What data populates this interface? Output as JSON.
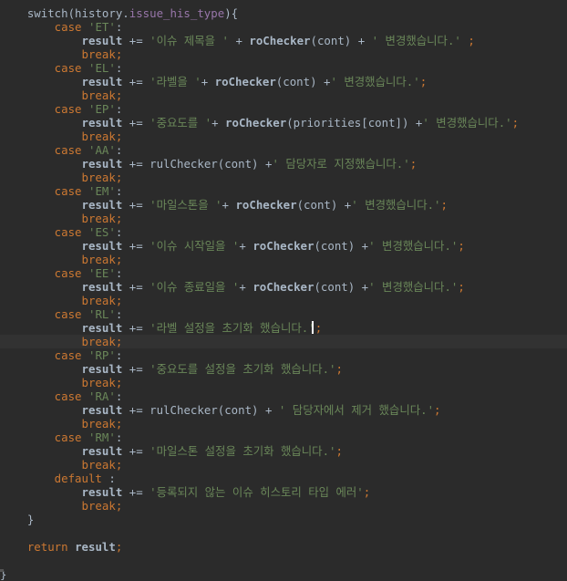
{
  "colors": {
    "background": "#2b2b2b",
    "current_line": "#323232",
    "default_text": "#a9b7c6",
    "keyword": "#cc7832",
    "string": "#6a8759",
    "function": "#ffc66d",
    "field": "#9876aa",
    "caret": "#ffffff"
  },
  "editor": {
    "caret_line": 24,
    "lines": [
      [
        {
          "t": "    switch(history.",
          "c": "plain"
        },
        {
          "t": "issue_his_type",
          "c": "fld"
        },
        {
          "t": "){",
          "c": "plain"
        }
      ],
      [
        {
          "t": "        case ",
          "c": "kw"
        },
        {
          "t": "'ET'",
          "c": "str"
        },
        {
          "t": ":",
          "c": "plain"
        }
      ],
      [
        {
          "t": "            result ",
          "c": "plain bold"
        },
        {
          "t": "+= ",
          "c": "plain"
        },
        {
          "t": "'이슈 제목을 ' ",
          "c": "str"
        },
        {
          "t": "+ ",
          "c": "plain"
        },
        {
          "t": "roChecker",
          "c": "plain bold"
        },
        {
          "t": "(cont) + ",
          "c": "plain"
        },
        {
          "t": "' 변경했습니다.' ",
          "c": "str"
        },
        {
          "t": ";",
          "c": "kw"
        }
      ],
      [
        {
          "t": "            break",
          "c": "kw"
        },
        {
          "t": ";",
          "c": "kw"
        }
      ],
      [
        {
          "t": "        case ",
          "c": "kw"
        },
        {
          "t": "'EL'",
          "c": "str"
        },
        {
          "t": ":",
          "c": "plain"
        }
      ],
      [
        {
          "t": "            result ",
          "c": "plain bold"
        },
        {
          "t": "+= ",
          "c": "plain"
        },
        {
          "t": "'라벨을 '",
          "c": "str"
        },
        {
          "t": "+ ",
          "c": "plain"
        },
        {
          "t": "roChecker",
          "c": "plain bold"
        },
        {
          "t": "(cont) +",
          "c": "plain"
        },
        {
          "t": "' 변경했습니다.'",
          "c": "str"
        },
        {
          "t": ";",
          "c": "kw"
        }
      ],
      [
        {
          "t": "            break",
          "c": "kw"
        },
        {
          "t": ";",
          "c": "kw"
        }
      ],
      [
        {
          "t": "        case ",
          "c": "kw"
        },
        {
          "t": "'EP'",
          "c": "str"
        },
        {
          "t": ":",
          "c": "plain"
        }
      ],
      [
        {
          "t": "            result ",
          "c": "plain bold"
        },
        {
          "t": "+= ",
          "c": "plain"
        },
        {
          "t": "'중요도를 '",
          "c": "str"
        },
        {
          "t": "+ ",
          "c": "plain"
        },
        {
          "t": "roChecker",
          "c": "plain bold"
        },
        {
          "t": "(priorities[cont]) +",
          "c": "plain"
        },
        {
          "t": "' 변경했습니다.'",
          "c": "str"
        },
        {
          "t": ";",
          "c": "kw"
        }
      ],
      [
        {
          "t": "            break",
          "c": "kw"
        },
        {
          "t": ";",
          "c": "kw"
        }
      ],
      [
        {
          "t": "        case ",
          "c": "kw"
        },
        {
          "t": "'AA'",
          "c": "str"
        },
        {
          "t": ":",
          "c": "plain"
        }
      ],
      [
        {
          "t": "            result ",
          "c": "plain bold"
        },
        {
          "t": "+= ",
          "c": "plain"
        },
        {
          "t": "rulChecker",
          "c": "plain"
        },
        {
          "t": "(cont) +",
          "c": "plain"
        },
        {
          "t": "' 담당자로 지정했습니다.'",
          "c": "str"
        },
        {
          "t": ";",
          "c": "kw"
        }
      ],
      [
        {
          "t": "            break",
          "c": "kw"
        },
        {
          "t": ";",
          "c": "kw"
        }
      ],
      [
        {
          "t": "        case ",
          "c": "kw"
        },
        {
          "t": "'EM'",
          "c": "str"
        },
        {
          "t": ":",
          "c": "plain"
        }
      ],
      [
        {
          "t": "            result ",
          "c": "plain bold"
        },
        {
          "t": "+= ",
          "c": "plain"
        },
        {
          "t": "'마일스톤을 '",
          "c": "str"
        },
        {
          "t": "+ ",
          "c": "plain"
        },
        {
          "t": "roChecker",
          "c": "plain bold"
        },
        {
          "t": "(cont) +",
          "c": "plain"
        },
        {
          "t": "' 변경했습니다.'",
          "c": "str"
        },
        {
          "t": ";",
          "c": "kw"
        }
      ],
      [
        {
          "t": "            break",
          "c": "kw"
        },
        {
          "t": ";",
          "c": "kw"
        }
      ],
      [
        {
          "t": "        case ",
          "c": "kw"
        },
        {
          "t": "'ES'",
          "c": "str"
        },
        {
          "t": ":",
          "c": "plain"
        }
      ],
      [
        {
          "t": "            result ",
          "c": "plain bold"
        },
        {
          "t": "+= ",
          "c": "plain"
        },
        {
          "t": "'이슈 시작일을 '",
          "c": "str"
        },
        {
          "t": "+ ",
          "c": "plain"
        },
        {
          "t": "roChecker",
          "c": "plain bold"
        },
        {
          "t": "(cont) +",
          "c": "plain"
        },
        {
          "t": "' 변경했습니다.'",
          "c": "str"
        },
        {
          "t": ";",
          "c": "kw"
        }
      ],
      [
        {
          "t": "            break",
          "c": "kw"
        },
        {
          "t": ";",
          "c": "kw"
        }
      ],
      [
        {
          "t": "        case ",
          "c": "kw"
        },
        {
          "t": "'EE'",
          "c": "str"
        },
        {
          "t": ":",
          "c": "plain"
        }
      ],
      [
        {
          "t": "            result ",
          "c": "plain bold"
        },
        {
          "t": "+= ",
          "c": "plain"
        },
        {
          "t": "'이슈 종료일을 '",
          "c": "str"
        },
        {
          "t": "+ ",
          "c": "plain"
        },
        {
          "t": "roChecker",
          "c": "plain bold"
        },
        {
          "t": "(cont) +",
          "c": "plain"
        },
        {
          "t": "' 변경했습니다.'",
          "c": "str"
        },
        {
          "t": ";",
          "c": "kw"
        }
      ],
      [
        {
          "t": "            break",
          "c": "kw"
        },
        {
          "t": ";",
          "c": "kw"
        }
      ],
      [
        {
          "t": "        case ",
          "c": "kw"
        },
        {
          "t": "'RL'",
          "c": "str"
        },
        {
          "t": ":",
          "c": "plain"
        }
      ],
      [
        {
          "t": "            result ",
          "c": "plain bold"
        },
        {
          "t": "+= ",
          "c": "plain"
        },
        {
          "t": "'라벨 설정을 초기화 했습니다.'",
          "c": "str"
        },
        {
          "t": ";",
          "c": "kw"
        }
      ],
      [
        {
          "t": "            break",
          "c": "kw"
        },
        {
          "t": ";",
          "c": "kw"
        }
      ],
      [
        {
          "t": "        case ",
          "c": "kw"
        },
        {
          "t": "'RP'",
          "c": "str"
        },
        {
          "t": ":",
          "c": "plain"
        }
      ],
      [
        {
          "t": "            result ",
          "c": "plain bold"
        },
        {
          "t": "+= ",
          "c": "plain"
        },
        {
          "t": "'중요도를 설정을 초기화 했습니다.'",
          "c": "str"
        },
        {
          "t": ";",
          "c": "kw"
        }
      ],
      [
        {
          "t": "            break",
          "c": "kw"
        },
        {
          "t": ";",
          "c": "kw"
        }
      ],
      [
        {
          "t": "        case ",
          "c": "kw"
        },
        {
          "t": "'RA'",
          "c": "str"
        },
        {
          "t": ":",
          "c": "plain"
        }
      ],
      [
        {
          "t": "            result ",
          "c": "plain bold"
        },
        {
          "t": "+= ",
          "c": "plain"
        },
        {
          "t": "rulChecker",
          "c": "plain"
        },
        {
          "t": "(cont) + ",
          "c": "plain"
        },
        {
          "t": "' 담당자에서 제거 했습니다.'",
          "c": "str"
        },
        {
          "t": ";",
          "c": "kw"
        }
      ],
      [
        {
          "t": "            break",
          "c": "kw"
        },
        {
          "t": ";",
          "c": "kw"
        }
      ],
      [
        {
          "t": "        case ",
          "c": "kw"
        },
        {
          "t": "'RM'",
          "c": "str"
        },
        {
          "t": ":",
          "c": "plain"
        }
      ],
      [
        {
          "t": "            result ",
          "c": "plain bold"
        },
        {
          "t": "+= ",
          "c": "plain"
        },
        {
          "t": "'마일스톤 설정을 초기화 했습니다.'",
          "c": "str"
        },
        {
          "t": ";",
          "c": "kw"
        }
      ],
      [
        {
          "t": "            break",
          "c": "kw"
        },
        {
          "t": ";",
          "c": "kw"
        }
      ],
      [
        {
          "t": "        default ",
          "c": "kw"
        },
        {
          "t": ":",
          "c": "plain"
        }
      ],
      [
        {
          "t": "            result ",
          "c": "plain bold"
        },
        {
          "t": "+= ",
          "c": "plain"
        },
        {
          "t": "'등록되지 않는 이슈 히스토리 타입 에러'",
          "c": "str"
        },
        {
          "t": ";",
          "c": "kw"
        }
      ],
      [
        {
          "t": "            break",
          "c": "kw"
        },
        {
          "t": ";",
          "c": "kw"
        }
      ],
      [
        {
          "t": "    }",
          "c": "plain"
        }
      ],
      [],
      [
        {
          "t": "    return ",
          "c": "kw"
        },
        {
          "t": "result",
          "c": "plain bold"
        },
        {
          "t": ";",
          "c": "kw"
        }
      ],
      [],
      [
        {
          "t": "}",
          "c": "plain"
        }
      ]
    ]
  }
}
